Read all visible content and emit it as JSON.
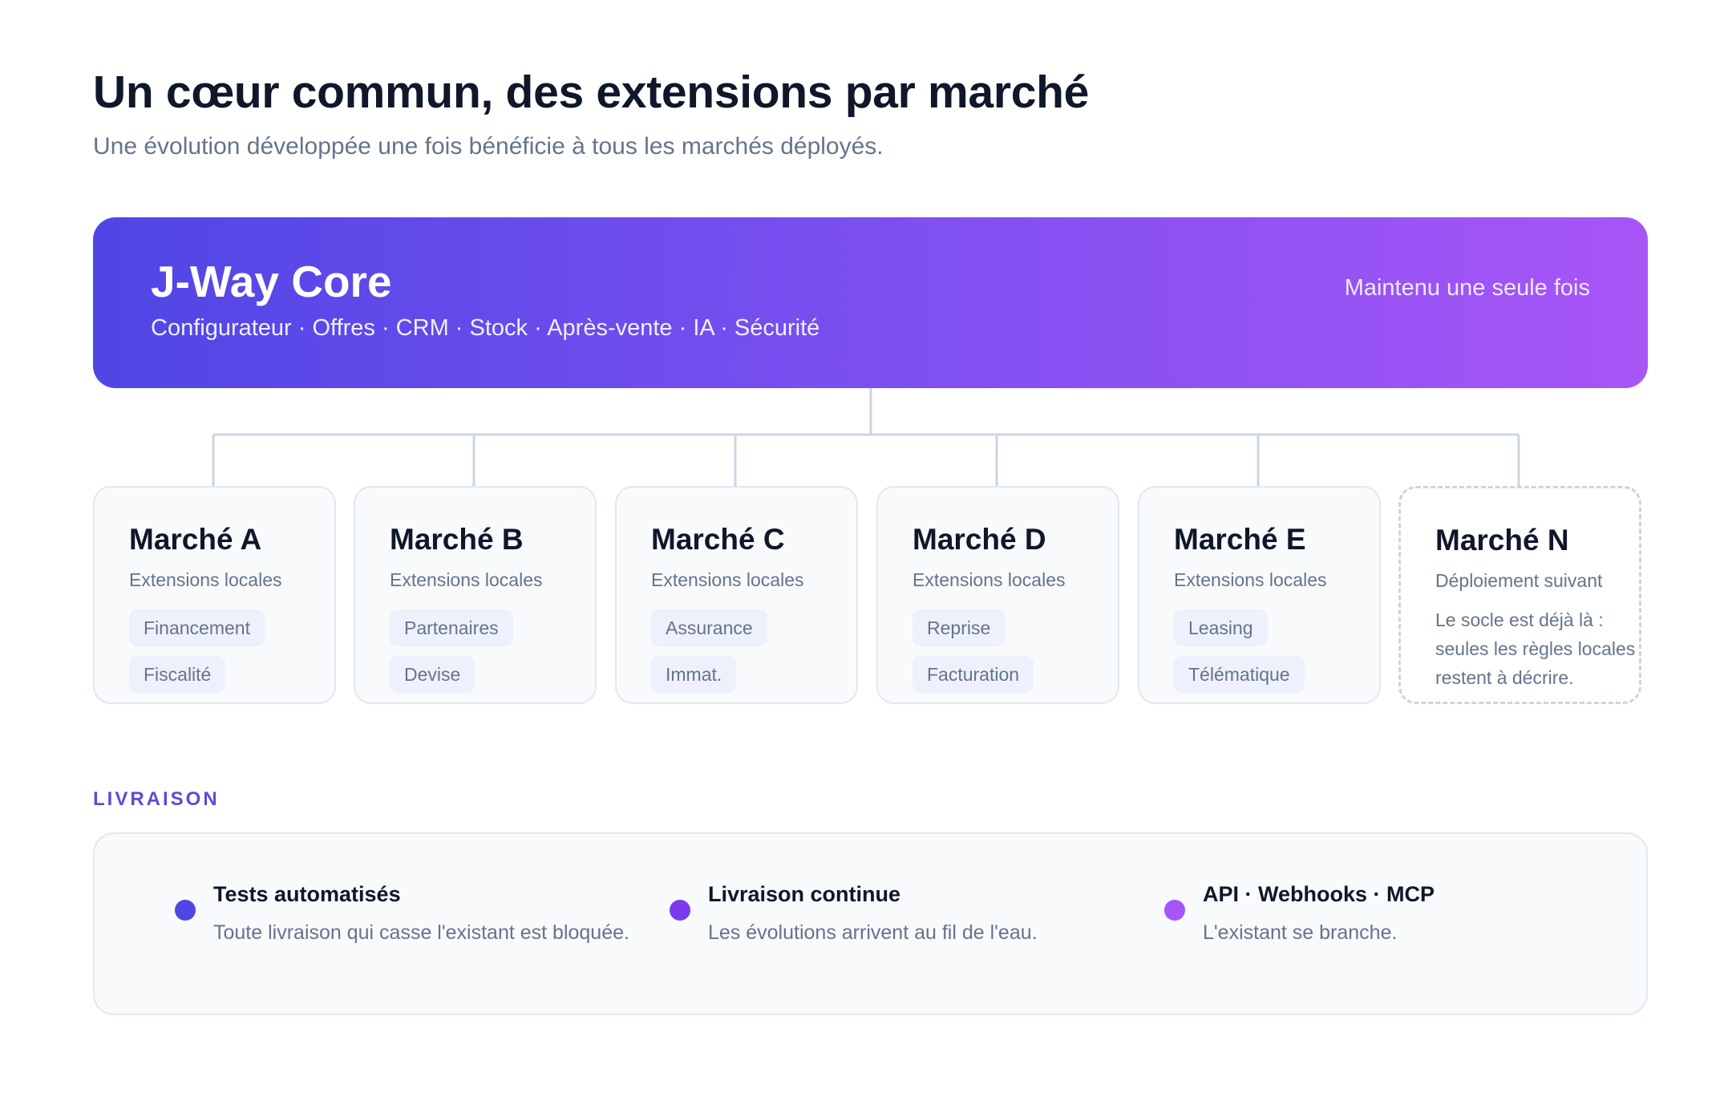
{
  "header": {
    "title": "Un cœur commun, des extensions par marché",
    "subtitle": "Une évolution développée une fois bénéficie à tous les marchés déployés."
  },
  "core": {
    "name": "J-Way Core",
    "modules": "Configurateur · Offres · CRM · Stock · Après-vente · IA · Sécurité",
    "note": "Maintenu une seule fois"
  },
  "markets": [
    {
      "name": "Marché A",
      "subtitle": "Extensions locales",
      "chips": [
        "Financement",
        "Fiscalité"
      ]
    },
    {
      "name": "Marché B",
      "subtitle": "Extensions locales",
      "chips": [
        "Partenaires",
        "Devise"
      ]
    },
    {
      "name": "Marché C",
      "subtitle": "Extensions locales",
      "chips": [
        "Assurance",
        "Immat."
      ]
    },
    {
      "name": "Marché D",
      "subtitle": "Extensions locales",
      "chips": [
        "Reprise",
        "Facturation"
      ]
    },
    {
      "name": "Marché E",
      "subtitle": "Extensions locales",
      "chips": [
        "Leasing",
        "Télématique"
      ]
    },
    {
      "name": "Marché N",
      "subtitle": "Déploiement suivant",
      "description": "Le socle est déjà là : seules les règles locales restent à décrire."
    }
  ],
  "delivery": {
    "label": "LIVRAISON",
    "items": [
      {
        "title": "Tests automatisés",
        "description": "Toute livraison qui casse l'existant est bloquée.",
        "dot_color": "#4f46e5"
      },
      {
        "title": "Livraison continue",
        "description": "Les évolutions arrivent au fil de l'eau.",
        "dot_color": "#7c3aed"
      },
      {
        "title": "API · Webhooks · MCP",
        "description": "L'existant se branche.",
        "dot_color": "#a855f7"
      }
    ]
  },
  "colors": {
    "gradient_start": "#4f46e5",
    "gradient_end": "#a855f7",
    "connector": "#cbd5e1",
    "accent_label": "#5b4bd6"
  }
}
